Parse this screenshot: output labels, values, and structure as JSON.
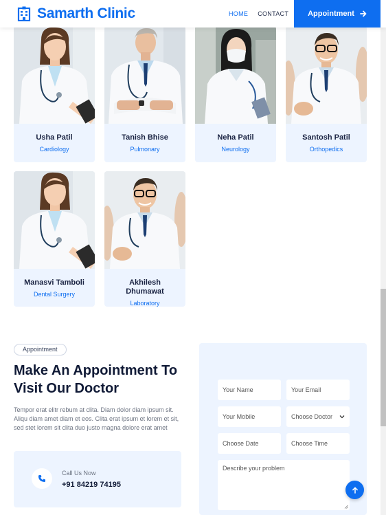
{
  "header": {
    "brand": "Samarth Clinic",
    "nav": [
      {
        "label": "HOME",
        "active": true
      },
      {
        "label": "CONTACT",
        "active": false
      }
    ],
    "cta_label": "Appointment"
  },
  "doctors": [
    {
      "name": "Usha Patil",
      "specialty": "Cardiology"
    },
    {
      "name": "Tanish Bhise",
      "specialty": "Pulmonary"
    },
    {
      "name": "Neha Patil",
      "specialty": "Neurology"
    },
    {
      "name": "Santosh Patil",
      "specialty": "Orthopedics"
    },
    {
      "name": "Manasvi Tamboli",
      "specialty": "Dental Surgery"
    },
    {
      "name": "Akhilesh Dhumawat",
      "specialty": "Laboratory"
    }
  ],
  "appointment": {
    "tag": "Appointment",
    "title": "Make An Appointment To Visit Our Doctor",
    "description": "Tempor erat elitr rebum at clita. Diam dolor diam ipsum sit. Aliqu diam amet diam et eos. Clita erat ipsum et lorem et sit, sed stet lorem sit clita duo justo magna dolore erat amet",
    "call_label": "Call Us Now",
    "call_number": "+91 84219 74195"
  },
  "form": {
    "name_placeholder": "Your Name",
    "email_placeholder": "Your Email",
    "mobile_placeholder": "Your Mobile",
    "doctor_select": "Choose Doctor",
    "date_placeholder": "Choose Date",
    "time_placeholder": "Choose Time",
    "problem_placeholder": "Describe your problem"
  },
  "colors": {
    "primary": "#0e6ef0",
    "light_bg": "#edf4ff",
    "heading": "#101a36"
  }
}
